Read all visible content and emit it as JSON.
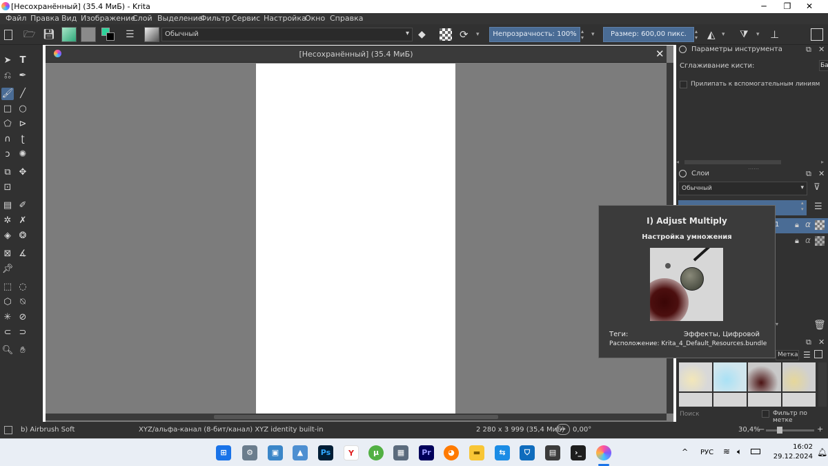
{
  "window": {
    "title": "[Несохранённый]  (35.4 МиБ)  - Krita",
    "min_icon": "─",
    "max_icon": "❐",
    "close_icon": "✕"
  },
  "menu": [
    "Файл",
    "Правка",
    "Вид",
    "Изображение",
    "Слой",
    "Выделение",
    "Фильтр",
    "Сервис",
    "Настройка",
    "Окно",
    "Справка"
  ],
  "toolbar": {
    "blend_mode": "Обычный",
    "opacity": "Непрозрачность: 100%",
    "size": "Размер: 600,00 пикс."
  },
  "document": {
    "title": "[Несохранённый]  (35.4 МиБ)",
    "close_icon": "✕"
  },
  "tool_options": {
    "title": "Параметры инструмента",
    "smoothing_label": "Сглаживание кисти:",
    "smoothing_value": "Ба",
    "snap_label": "Прилипать к вспомогательным линиям"
  },
  "layers": {
    "title": "Слои",
    "blend_mode": "Обычный",
    "layer1_suffix": "1"
  },
  "tooltip": {
    "title": "I) Adjust Multiply",
    "subtitle": "Настройка умножения",
    "tags_label": "Теги:",
    "tags_value": "Эффекты, Цифровой",
    "location": "Расположение: Krita_4_Default_Resources.bundle"
  },
  "presets": {
    "tag_partial": "Метка",
    "search_placeholder": "Поиск",
    "filter_label": "Фильтр по метке"
  },
  "status": {
    "brush": "b) Airbrush Soft",
    "colorspace": "XYZ/альфа-канал (8-бит/канал)  XYZ identity built-in",
    "dimensions": "2 280 x 3 999 (35,4 МиБ)",
    "rotation": "0,00°",
    "zoom": "30,4%"
  },
  "taskbar": {
    "lang": "РУС",
    "time": "16:02",
    "date": "29.12.2024",
    "apps": [
      "windows-start",
      "settings",
      "control-panel",
      "photos",
      "photoshop",
      "yandex",
      "utorrent",
      "calculator",
      "premiere",
      "firefox",
      "explorer",
      "teamviewer",
      "defender",
      "calendar-app",
      "terminal",
      "krita"
    ]
  },
  "colors": {
    "bg": "#313131",
    "accent": "#4a6c95",
    "canvas_bg": "#7c7c7c"
  }
}
